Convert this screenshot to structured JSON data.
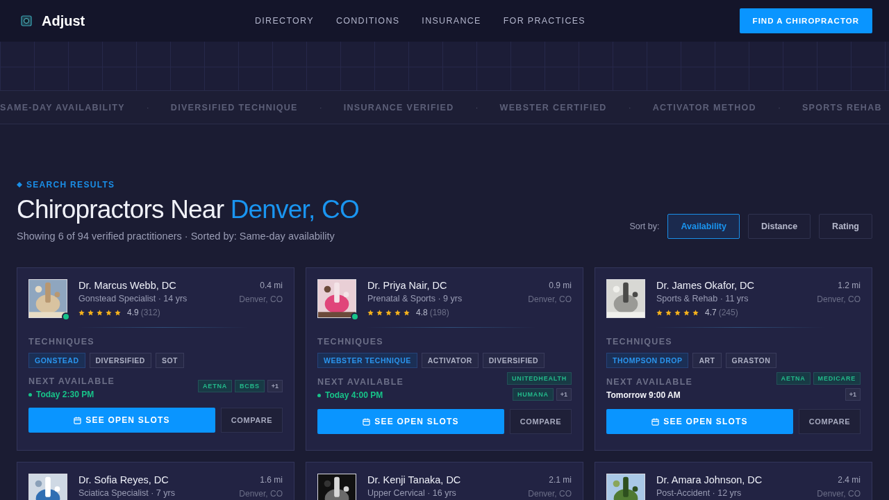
{
  "header": {
    "brand": "Adjust",
    "nav": [
      "DIRECTORY",
      "CONDITIONS",
      "INSURANCE",
      "FOR PRACTICES"
    ],
    "cta": "FIND A CHIROPRACTOR"
  },
  "ticker": [
    "SAME-DAY AVAILABILITY",
    "DIVERSIFIED TECHNIQUE",
    "INSURANCE VERIFIED",
    "WEBSTER CERTIFIED",
    "ACTIVATOR METHOD",
    "SPORTS REHAB"
  ],
  "ticker_separator": "·",
  "results": {
    "eyebrow": "SEARCH RESULTS",
    "title": "Chiropractors Near ",
    "title_highlight": "Denver, CO",
    "summary": "Showing 6 of 94 verified practitioners · Sorted by: Same-day availability",
    "sort_label": "Sort by:",
    "sort_options": [
      {
        "label": "Availability",
        "selected": true
      },
      {
        "label": "Distance",
        "selected": false
      },
      {
        "label": "Rating",
        "selected": false
      }
    ]
  },
  "cards": [
    {
      "name": "Dr. Marcus Webb, DC",
      "specialty": "Gonstead Specialist · 14 yrs",
      "distance": "0.4 mi",
      "city": "Denver, CO",
      "online": true,
      "stars": 5,
      "rating": "4.9",
      "reviews": "(312)",
      "techniques_label": "TECHNIQUES",
      "techniques": [
        {
          "label": "GONSTEAD",
          "primary": true
        },
        {
          "label": "DIVERSIFIED",
          "primary": false
        },
        {
          "label": "SOT",
          "primary": false
        }
      ],
      "next_label": "NEXT AVAILABLE",
      "next": "Today 2:30 PM",
      "same_day": true,
      "insurance": [
        "AETNA",
        "BCBS"
      ],
      "insurance_more": "+1",
      "book": "SEE OPEN SLOTS",
      "compare": "COMPARE"
    },
    {
      "name": "Dr. Priya Nair, DC",
      "specialty": "Prenatal & Sports · 9 yrs",
      "distance": "0.9 mi",
      "city": "Denver, CO",
      "online": true,
      "stars": 5,
      "rating": "4.8",
      "reviews": "(198)",
      "techniques_label": "TECHNIQUES",
      "techniques": [
        {
          "label": "WEBSTER TECHNIQUE",
          "primary": true
        },
        {
          "label": "ACTIVATOR",
          "primary": false
        },
        {
          "label": "DIVERSIFIED",
          "primary": false
        }
      ],
      "next_label": "NEXT AVAILABLE",
      "next": "Today 4:00 PM",
      "same_day": true,
      "insurance": [
        "UNITEDHEALTH",
        "HUMANA"
      ],
      "insurance_more": "+1",
      "book": "SEE OPEN SLOTS",
      "compare": "COMPARE"
    },
    {
      "name": "Dr. James Okafor, DC",
      "specialty": "Sports & Rehab · 11 yrs",
      "distance": "1.2 mi",
      "city": "Denver, CO",
      "online": false,
      "stars": 5,
      "rating": "4.7",
      "reviews": "(245)",
      "techniques_label": "TECHNIQUES",
      "techniques": [
        {
          "label": "THOMPSON DROP",
          "primary": true
        },
        {
          "label": "ART",
          "primary": false
        },
        {
          "label": "GRASTON",
          "primary": false
        }
      ],
      "next_label": "NEXT AVAILABLE",
      "next": "Tomorrow 9:00 AM",
      "same_day": false,
      "insurance": [
        "AETNA",
        "MEDICARE"
      ],
      "insurance_more": "+1",
      "book": "SEE OPEN SLOTS",
      "compare": "COMPARE"
    },
    {
      "name": "Dr. Sofia Reyes, DC",
      "specialty": "Sciatica Specialist · 7 yrs",
      "distance": "1.6 mi",
      "city": "Denver, CO"
    },
    {
      "name": "Dr. Kenji Tanaka, DC",
      "specialty": "Upper Cervical · 16 yrs",
      "distance": "2.1 mi",
      "city": "Denver, CO"
    },
    {
      "name": "Dr. Amara Johnson, DC",
      "specialty": "Post-Accident · 12 yrs",
      "distance": "2.4 mi",
      "city": "Denver, CO"
    }
  ]
}
